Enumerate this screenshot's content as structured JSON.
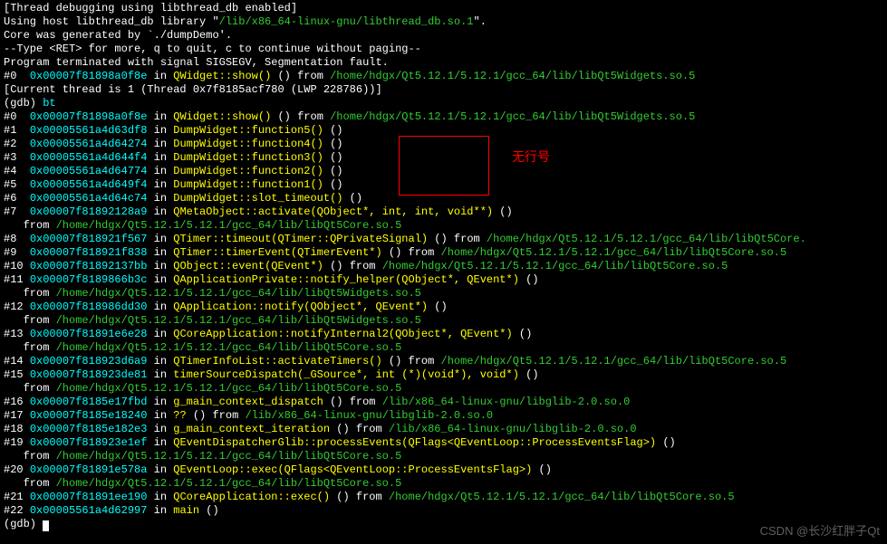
{
  "header": {
    "l0": "[Thread debugging using libthread_db enabled]",
    "l1a": "Using host libthread_db library \"",
    "l1b": "/lib/x86_64-linux-gnu/libthread_db.so.1",
    "l1c": "\".",
    "l2": "Core was generated by `./dumpDemo'.",
    "l3": "--Type <RET> for more, q to quit, c to continue without paging--",
    "l4": "Program terminated with signal SIGSEGV, Segmentation fault.",
    "l5a": "#0  ",
    "l5b": "0x00007f81898a0f8e",
    "l5c": " in ",
    "l5d": "QWidget::show()",
    "l5e": " () from ",
    "l5f": "/home/hdgx/Qt5.12.1/5.12.1/gcc_64/lib/libQt5Widgets.so.5",
    "l6": "[Current thread is 1 (Thread 0x7f8185acf780 (LWP 228786))]",
    "l7a": "(gdb) ",
    "l7b": "bt"
  },
  "frames": [
    {
      "n": "#0  ",
      "addr": "0x00007f81898a0f8e",
      "in": " in ",
      "fn": "QWidget::show()",
      "args": " () from ",
      "from": "/home/hdgx/Qt5.12.1/5.12.1/gcc_64/lib/libQt5Widgets.so.5"
    },
    {
      "n": "#1  ",
      "addr": "0x00005561a4d63df8",
      "in": " in ",
      "fn": "DumpWidget::function5()",
      "args": " ()"
    },
    {
      "n": "#2  ",
      "addr": "0x00005561a4d64274",
      "in": " in ",
      "fn": "DumpWidget::function4()",
      "args": " ()"
    },
    {
      "n": "#3  ",
      "addr": "0x00005561a4d644f4",
      "in": " in ",
      "fn": "DumpWidget::function3()",
      "args": " ()"
    },
    {
      "n": "#4  ",
      "addr": "0x00005561a4d64774",
      "in": " in ",
      "fn": "DumpWidget::function2()",
      "args": " ()"
    },
    {
      "n": "#5  ",
      "addr": "0x00005561a4d649f4",
      "in": " in ",
      "fn": "DumpWidget::function1()",
      "args": " ()"
    },
    {
      "n": "#6  ",
      "addr": "0x00005561a4d64c74",
      "in": " in ",
      "fn": "DumpWidget::slot_timeout()",
      "args": " ()"
    },
    {
      "n": "#7  ",
      "addr": "0x00007f81892128a9",
      "in": " in ",
      "fn": "QMetaObject::activate(QObject*, int, int, void**)",
      "args": " ()",
      "cont": true,
      "from": "/home/hdgx/Qt5.12.1/5.12.1/gcc_64/lib/libQt5Core.so.5"
    },
    {
      "n": "#8  ",
      "addr": "0x00007f818921f567",
      "in": " in ",
      "fn": "QTimer::timeout(QTimer::QPrivateSignal)",
      "args": " () from ",
      "from": "/home/hdgx/Qt5.12.1/5.12.1/gcc_64/lib/libQt5Core."
    },
    {
      "n": "#9  ",
      "addr": "0x00007f818921f838",
      "in": " in ",
      "fn": "QTimer::timerEvent(QTimerEvent*)",
      "args": " () from ",
      "from": "/home/hdgx/Qt5.12.1/5.12.1/gcc_64/lib/libQt5Core.so.5"
    },
    {
      "n": "#10 ",
      "addr": "0x00007f81892137bb",
      "in": " in ",
      "fn": "QObject::event(QEvent*)",
      "args": " () from ",
      "from": "/home/hdgx/Qt5.12.1/5.12.1/gcc_64/lib/libQt5Core.so.5"
    },
    {
      "n": "#11 ",
      "addr": "0x00007f8189866b3c",
      "in": " in ",
      "fn": "QApplicationPrivate::notify_helper(QObject*, QEvent*)",
      "args": " ()",
      "cont": true,
      "from": "/home/hdgx/Qt5.12.1/5.12.1/gcc_64/lib/libQt5Widgets.so.5"
    },
    {
      "n": "#12 ",
      "addr": "0x00007f818986dd30",
      "in": " in ",
      "fn": "QApplication::notify(QObject*, QEvent*)",
      "args": " ()",
      "cont": true,
      "from": "/home/hdgx/Qt5.12.1/5.12.1/gcc_64/lib/libQt5Widgets.so.5"
    },
    {
      "n": "#13 ",
      "addr": "0x00007f81891e6e28",
      "in": " in ",
      "fn": "QCoreApplication::notifyInternal2(QObject*, QEvent*)",
      "args": " ()",
      "cont": true,
      "from": "/home/hdgx/Qt5.12.1/5.12.1/gcc_64/lib/libQt5Core.so.5"
    },
    {
      "n": "#14 ",
      "addr": "0x00007f818923d6a9",
      "in": " in ",
      "fn": "QTimerInfoList::activateTimers()",
      "args": " () from ",
      "from": "/home/hdgx/Qt5.12.1/5.12.1/gcc_64/lib/libQt5Core.so.5"
    },
    {
      "n": "#15 ",
      "addr": "0x00007f818923de81",
      "in": " in ",
      "fn": "timerSourceDispatch(_GSource*, int (*)(void*), void*)",
      "args": " ()",
      "cont": true,
      "from": "/home/hdgx/Qt5.12.1/5.12.1/gcc_64/lib/libQt5Core.so.5"
    },
    {
      "n": "#16 ",
      "addr": "0x00007f8185e17fbd",
      "in": " in ",
      "fn": "g_main_context_dispatch",
      "args": " () from ",
      "from": "/lib/x86_64-linux-gnu/libglib-2.0.so.0"
    },
    {
      "n": "#17 ",
      "addr": "0x00007f8185e18240",
      "in": " in ",
      "fn": "??",
      "args": " () from ",
      "from": "/lib/x86_64-linux-gnu/libglib-2.0.so.0"
    },
    {
      "n": "#18 ",
      "addr": "0x00007f8185e182e3",
      "in": " in ",
      "fn": "g_main_context_iteration",
      "args": " () from ",
      "from": "/lib/x86_64-linux-gnu/libglib-2.0.so.0"
    },
    {
      "n": "#19 ",
      "addr": "0x00007f818923e1ef",
      "in": " in ",
      "fn": "QEventDispatcherGlib::processEvents(QFlags<QEventLoop::ProcessEventsFlag>)",
      "args": " ()",
      "cont": true,
      "from": "/home/hdgx/Qt5.12.1/5.12.1/gcc_64/lib/libQt5Core.so.5"
    },
    {
      "n": "#20 ",
      "addr": "0x00007f81891e578a",
      "in": " in ",
      "fn": "QEventLoop::exec(QFlags<QEventLoop::ProcessEventsFlag>)",
      "args": " ()",
      "cont": true,
      "from": "/home/hdgx/Qt5.12.1/5.12.1/gcc_64/lib/libQt5Core.so.5"
    },
    {
      "n": "#21 ",
      "addr": "0x00007f81891ee190",
      "in": " in ",
      "fn": "QCoreApplication::exec()",
      "args": " () from ",
      "from": "/home/hdgx/Qt5.12.1/5.12.1/gcc_64/lib/libQt5Core.so.5"
    },
    {
      "n": "#22 ",
      "addr": "0x00005561a4d62997",
      "in": " in ",
      "fn": "main",
      "args": " ()"
    }
  ],
  "fromPrefix": "   from ",
  "prompt": "(gdb) ",
  "annotation": "无行号",
  "watermark": "CSDN @长沙红胖子Qt"
}
